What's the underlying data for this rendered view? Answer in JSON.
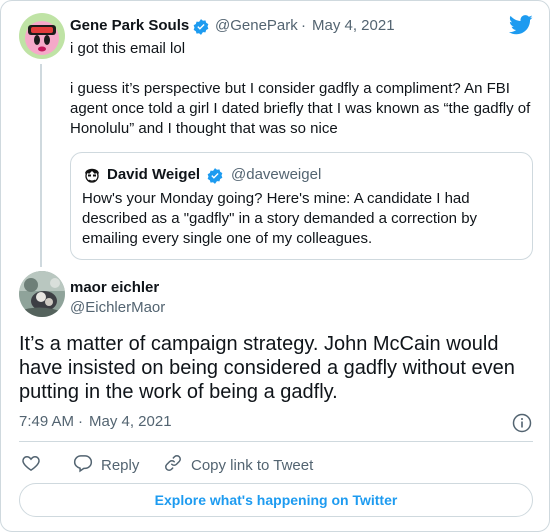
{
  "tweet": {
    "author_name": "Gene Park Souls",
    "author_handle": "@GenePark",
    "separator": "·",
    "date": "May 4, 2021",
    "line1": "i got this email lol",
    "line2": "i guess it’s perspective but I consider gadfly a compliment? An FBI agent once told a girl I dated briefly that I was known as “the gadfly of Honolulu” and I thought that was so nice",
    "quoted": {
      "author_name": "David Weigel",
      "author_handle": "@daveweigel",
      "text": "How's your Monday going? Here's mine: A candidate I had described as a \"gadfly\" in a story demanded a correction by emailing every single one of my colleagues."
    }
  },
  "reply": {
    "author_name": "maor eichler",
    "author_handle": "@EichlerMaor",
    "text": "It’s a matter of campaign strategy. John McCain would have insisted on being considered a gadfly without even putting in the work of being a gadfly.",
    "time": "7:49 AM",
    "separator": "·",
    "date": "May 4, 2021"
  },
  "actions": {
    "reply_label": "Reply",
    "copy_link_label": "Copy link to Tweet"
  },
  "footer": {
    "explore_label": "Explore what's happening on Twitter"
  },
  "icons": {
    "brand": "twitter-bird-icon",
    "verified": "verified-badge-icon",
    "info": "info-icon",
    "like": "heart-icon",
    "reply": "reply-bubble-icon",
    "copy_link": "link-icon"
  },
  "colors": {
    "twitter_blue": "#1d9bf0",
    "text": "#0f1419",
    "muted": "#536471",
    "border": "#cfd9de"
  }
}
